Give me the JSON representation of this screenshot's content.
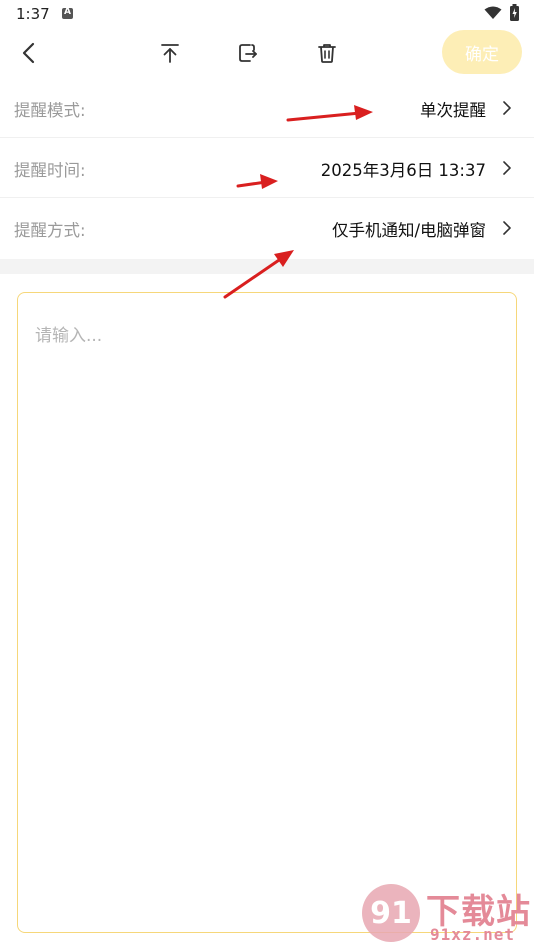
{
  "status_bar": {
    "time": "1:37",
    "notification_icon": "app-notification-icon",
    "wifi_icon": "wifi-icon",
    "battery_icon": "battery-charging-icon"
  },
  "toolbar": {
    "back_icon": "chevron-left-icon",
    "pin_top_icon": "pin-to-top-icon",
    "export_icon": "export-icon",
    "delete_icon": "trash-icon",
    "confirm_label": "确定",
    "confirm_color": "#fdeeb6"
  },
  "settings": [
    {
      "label": "提醒模式:",
      "value": "单次提醒"
    },
    {
      "label": "提醒时间:",
      "value": "2025年3月6日 13:37"
    },
    {
      "label": "提醒方式:",
      "value": "仅手机通知/电脑弹窗"
    }
  ],
  "editor": {
    "placeholder": "请输入...",
    "value": "",
    "border_color": "#f6d77a"
  },
  "annotation": {
    "arrow_color": "#d91f1f"
  },
  "watermark": {
    "logo_text": "91",
    "title": "下载站",
    "url": "91xz.net"
  }
}
